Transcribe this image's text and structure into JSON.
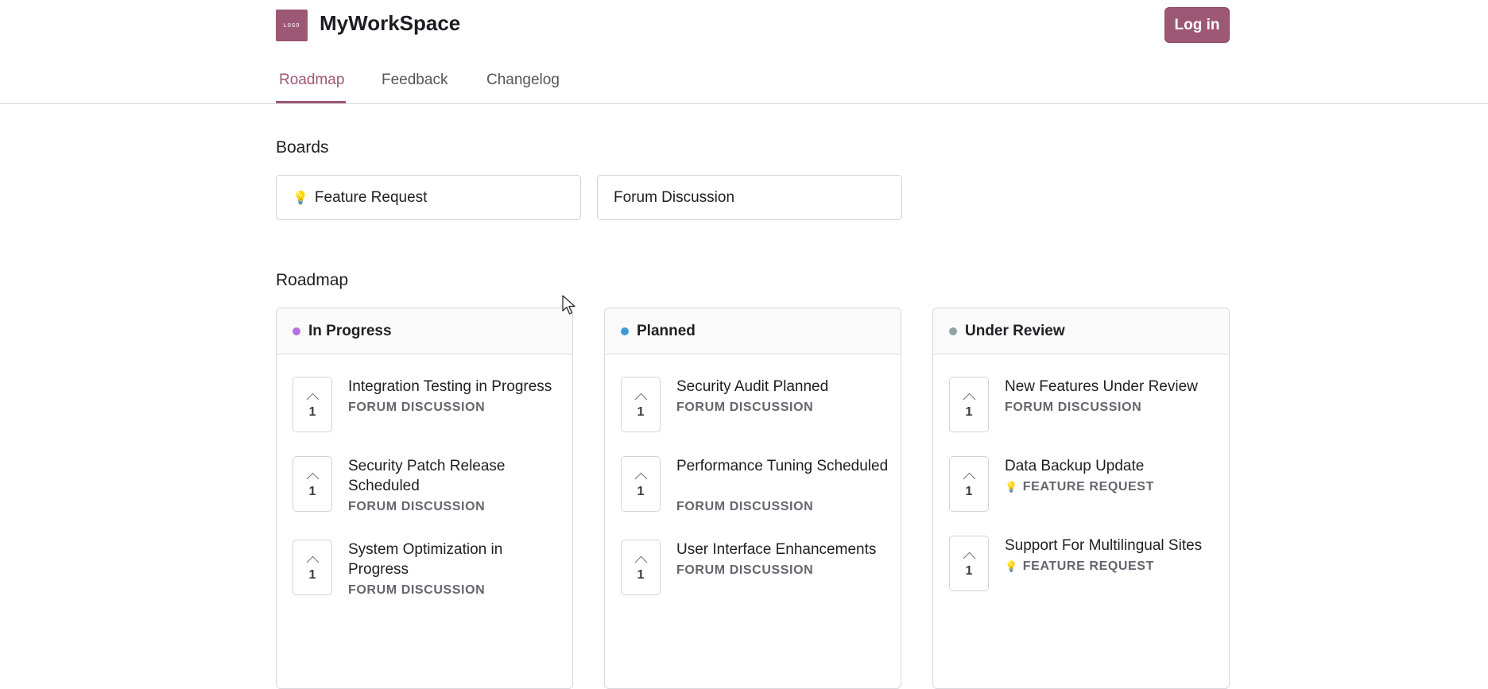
{
  "header": {
    "logo_text": "LOGO",
    "brand": "MyWorkSpace",
    "login_label": "Log in"
  },
  "nav": {
    "tabs": [
      {
        "label": "Roadmap"
      },
      {
        "label": "Feedback"
      },
      {
        "label": "Changelog"
      }
    ]
  },
  "boards": {
    "title": "Boards",
    "items": [
      {
        "label": "Feature Request",
        "icon": "lightbulb-icon"
      },
      {
        "label": "Forum Discussion"
      }
    ]
  },
  "roadmap": {
    "title": "Roadmap",
    "columns": [
      {
        "label": "In Progress",
        "color": "#b76ee0",
        "cards": [
          {
            "title": "Integration Testing in Progress",
            "tag": "FORUM DISCUSSION",
            "votes": "1"
          },
          {
            "title": "Security Patch Release Scheduled",
            "tag": "FORUM DISCUSSION",
            "votes": "1"
          },
          {
            "title": "System Optimization in Progress",
            "tag": "FORUM DISCUSSION",
            "votes": "1"
          }
        ]
      },
      {
        "label": "Planned",
        "color": "#3d9ad9",
        "cards": [
          {
            "title": "Security Audit Planned",
            "tag": "FORUM DISCUSSION",
            "votes": "1"
          },
          {
            "title": "Performance Tuning Scheduled",
            "tag": "FORUM DISCUSSION",
            "votes": "1"
          },
          {
            "title": "User Interface Enhancements",
            "tag": "FORUM DISCUSSION",
            "votes": "1"
          }
        ]
      },
      {
        "label": "Under Review",
        "color": "#8fa3a3",
        "cards": [
          {
            "title": "New Features Under Review",
            "tag": "FORUM DISCUSSION",
            "votes": "1"
          },
          {
            "title": "Data Backup Update",
            "tag": "FEATURE REQUEST",
            "votes": "1"
          },
          {
            "title": "Support For Multilingual Sites",
            "tag": "FEATURE REQUEST",
            "votes": "1"
          }
        ]
      }
    ]
  },
  "colors": {
    "accent": "#9c5874"
  }
}
